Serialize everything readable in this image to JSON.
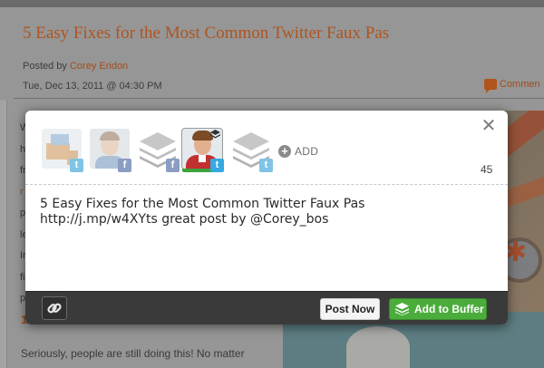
{
  "page": {
    "post_title": "5 Easy Fixes for the Most Common Twitter Faux Pas",
    "posted_by_prefix": "Posted by ",
    "author": "Corey Eridon",
    "date": "Tue, Dec 13, 2011 @ 04:30 PM",
    "comment_link": "Commen",
    "left_fragments": [
      "W",
      "h",
      "fr",
      "r",
      "p",
      "le",
      "Ir",
      "fi",
      "p"
    ],
    "sub_heading": "1. ",
    "body_line": "Seriously, people are still doing this! No matter"
  },
  "dialog": {
    "close_glyph": "✕",
    "profiles": [
      {
        "name": "art-avatar",
        "network": "twitter",
        "badge": "t",
        "selected": false
      },
      {
        "name": "face-avatar",
        "network": "facebook",
        "badge": "f",
        "selected": false
      },
      {
        "name": "default-avatar",
        "network": "facebook",
        "badge": "f",
        "selected": false
      },
      {
        "name": "selected-avatar",
        "network": "twitter",
        "badge": "t",
        "selected": true
      },
      {
        "name": "default-avatar-2",
        "network": "twitter",
        "badge": "t",
        "selected": false
      }
    ],
    "add_label": "ADD",
    "add_glyph": "+",
    "char_count": "45",
    "message": "5 Easy Fixes for the Most Common Twitter Faux Pas\nhttp://j.mp/w4XYts great post by @Corey_bos",
    "footer": {
      "post_now_label": "Post Now",
      "add_to_buffer_label": "Add to Buffer"
    }
  },
  "colors": {
    "accent_green": "#4bac3c",
    "title_orange": "#b0541e",
    "twitter_blue": "#36a9e1",
    "facebook_blue": "#8b9dc3"
  }
}
